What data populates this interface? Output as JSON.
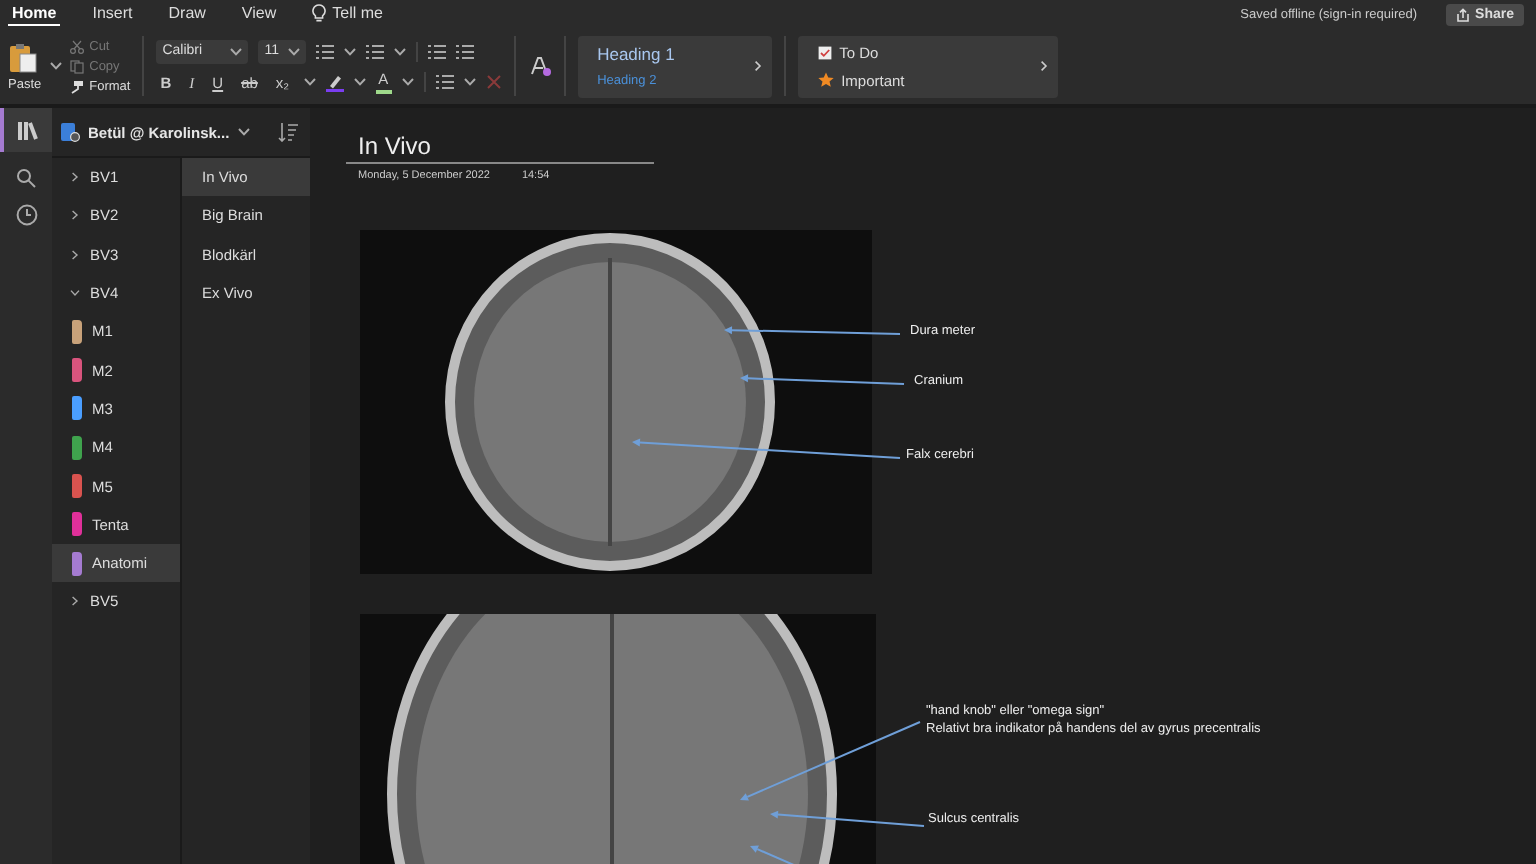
{
  "menu_tabs": [
    {
      "label": "Home",
      "selected": true,
      "kind": "tab"
    },
    {
      "label": "Insert",
      "selected": false,
      "kind": "tab"
    },
    {
      "label": "Draw",
      "selected": false,
      "kind": "tab"
    },
    {
      "label": "View",
      "selected": false,
      "kind": "tab"
    },
    {
      "label": "Tell me",
      "selected": false,
      "kind": "search"
    }
  ],
  "status": "Saved offline (sign-in required)",
  "share_button": "Share",
  "ribbon": {
    "paste": "Paste",
    "clipboard": [
      {
        "label": "Cut",
        "disabled": true
      },
      {
        "label": "Copy",
        "disabled": true
      },
      {
        "label": "Format",
        "disabled": false
      }
    ],
    "font": "Calibri",
    "font_size": "11",
    "format_buttons": [
      {
        "label": "B",
        "kind": "bold"
      },
      {
        "label": "I",
        "kind": "italic"
      },
      {
        "label": "U",
        "kind": "underline"
      },
      {
        "label": "ab",
        "kind": "strike"
      },
      {
        "label": "x₂",
        "kind": "plain"
      }
    ],
    "font_color_glyph": "A",
    "styles": [
      "Heading 1",
      "Heading 2"
    ],
    "tags": [
      {
        "label": "To Do",
        "kind": "todo"
      },
      {
        "label": "Important",
        "kind": "star"
      }
    ]
  },
  "notebook": {
    "name": "Betül @ Karolinsk...",
    "sections": [
      {
        "label": "BV1",
        "expanded": false,
        "selected": false
      },
      {
        "label": "BV2",
        "expanded": false,
        "selected": false
      },
      {
        "label": "BV3",
        "expanded": false,
        "selected": false
      },
      {
        "label": "BV4",
        "expanded": true,
        "selected": false,
        "children": [
          {
            "label": "M1",
            "color": "#c8a27a",
            "selected": false
          },
          {
            "label": "M2",
            "color": "#d9547d",
            "selected": false
          },
          {
            "label": "M3",
            "color": "#4a9eff",
            "selected": false
          },
          {
            "label": "M4",
            "color": "#3fa34d",
            "selected": false
          },
          {
            "label": "M5",
            "color": "#d9534f",
            "selected": false
          },
          {
            "label": "Tenta",
            "color": "#e0309a",
            "selected": false
          },
          {
            "label": "Anatomi",
            "color": "#a57bd1",
            "selected": true
          }
        ]
      },
      {
        "label": "BV5",
        "expanded": false,
        "selected": false
      }
    ],
    "pages": [
      {
        "label": "In Vivo",
        "selected": true
      },
      {
        "label": "Big Brain",
        "selected": false
      },
      {
        "label": "Blodkärl",
        "selected": false
      },
      {
        "label": "Ex Vivo",
        "selected": false
      }
    ]
  },
  "page": {
    "title": "In Vivo",
    "date": "Monday, 5 December 2022",
    "time": "14:54",
    "annotations": [
      {
        "lines": [
          "Dura meter"
        ]
      },
      {
        "lines": [
          "Cranium"
        ]
      },
      {
        "lines": [
          "Falx cerebri"
        ]
      },
      {
        "lines": [
          "\"hand knob\" eller \"omega sign\"",
          "Relativt bra indikator på handens del av gyrus precentralis"
        ]
      },
      {
        "lines": [
          "Sulcus centralis"
        ]
      }
    ]
  }
}
